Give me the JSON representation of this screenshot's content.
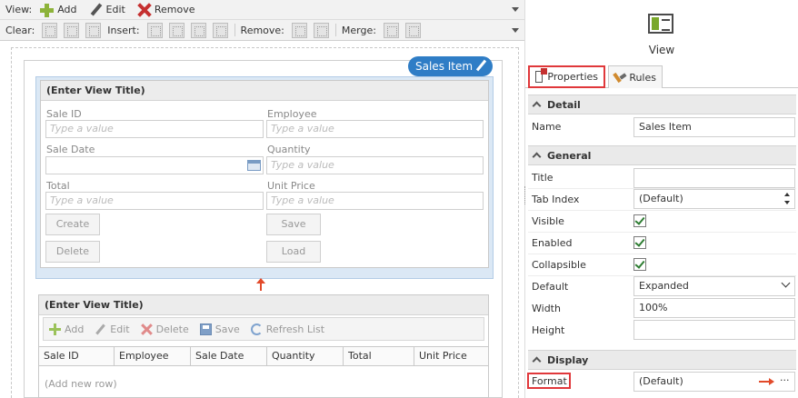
{
  "toolbar_view": {
    "label": "View:",
    "add": "Add",
    "edit": "Edit",
    "remove": "Remove"
  },
  "toolbar_layout": {
    "clear": "Clear:",
    "insert": "Insert:",
    "remove": "Remove:",
    "merge": "Merge:"
  },
  "view_badge": "Sales Item",
  "form_view": {
    "title": "(Enter View Title)",
    "fields": [
      {
        "label": "Sale ID",
        "placeholder": "Type a value"
      },
      {
        "label": "Employee",
        "placeholder": "Type a value"
      },
      {
        "label": "Sale Date",
        "placeholder": ""
      },
      {
        "label": "Quantity",
        "placeholder": "Type a value"
      },
      {
        "label": "Total",
        "placeholder": "Type a value"
      },
      {
        "label": "Unit Price",
        "placeholder": "Type a value"
      }
    ],
    "buttons": {
      "create": "Create",
      "save": "Save",
      "delete": "Delete",
      "load": "Load"
    }
  },
  "list_view": {
    "title": "(Enter View Title)",
    "toolbar": {
      "add": "Add",
      "edit": "Edit",
      "delete": "Delete",
      "save": "Save",
      "refresh": "Refresh List"
    },
    "columns": [
      "Sale ID",
      "Employee",
      "Sale Date",
      "Quantity",
      "Total",
      "Unit Price"
    ],
    "add_row": "(Add new row)"
  },
  "properties": {
    "header": "View",
    "tabs": {
      "properties": "Properties",
      "rules": "Rules"
    },
    "sections": {
      "detail": "Detail",
      "general": "General",
      "display": "Display"
    },
    "name": {
      "label": "Name",
      "value": "Sales Item"
    },
    "title": {
      "label": "Title",
      "value": ""
    },
    "tab_index": {
      "label": "Tab Index",
      "value": "(Default)"
    },
    "visible": {
      "label": "Visible",
      "checked": true
    },
    "enabled": {
      "label": "Enabled",
      "checked": true
    },
    "collapsible": {
      "label": "Collapsible",
      "checked": true
    },
    "default": {
      "label": "Default",
      "value": "Expanded"
    },
    "width": {
      "label": "Width",
      "value": "100%"
    },
    "height": {
      "label": "Height",
      "value": ""
    },
    "format": {
      "label": "Format",
      "value": "(Default)",
      "ellipsis": "···"
    }
  },
  "colors": {
    "accent": "#2f7dc6",
    "highlight": "#e0383b",
    "add_green": "#8db33a"
  }
}
